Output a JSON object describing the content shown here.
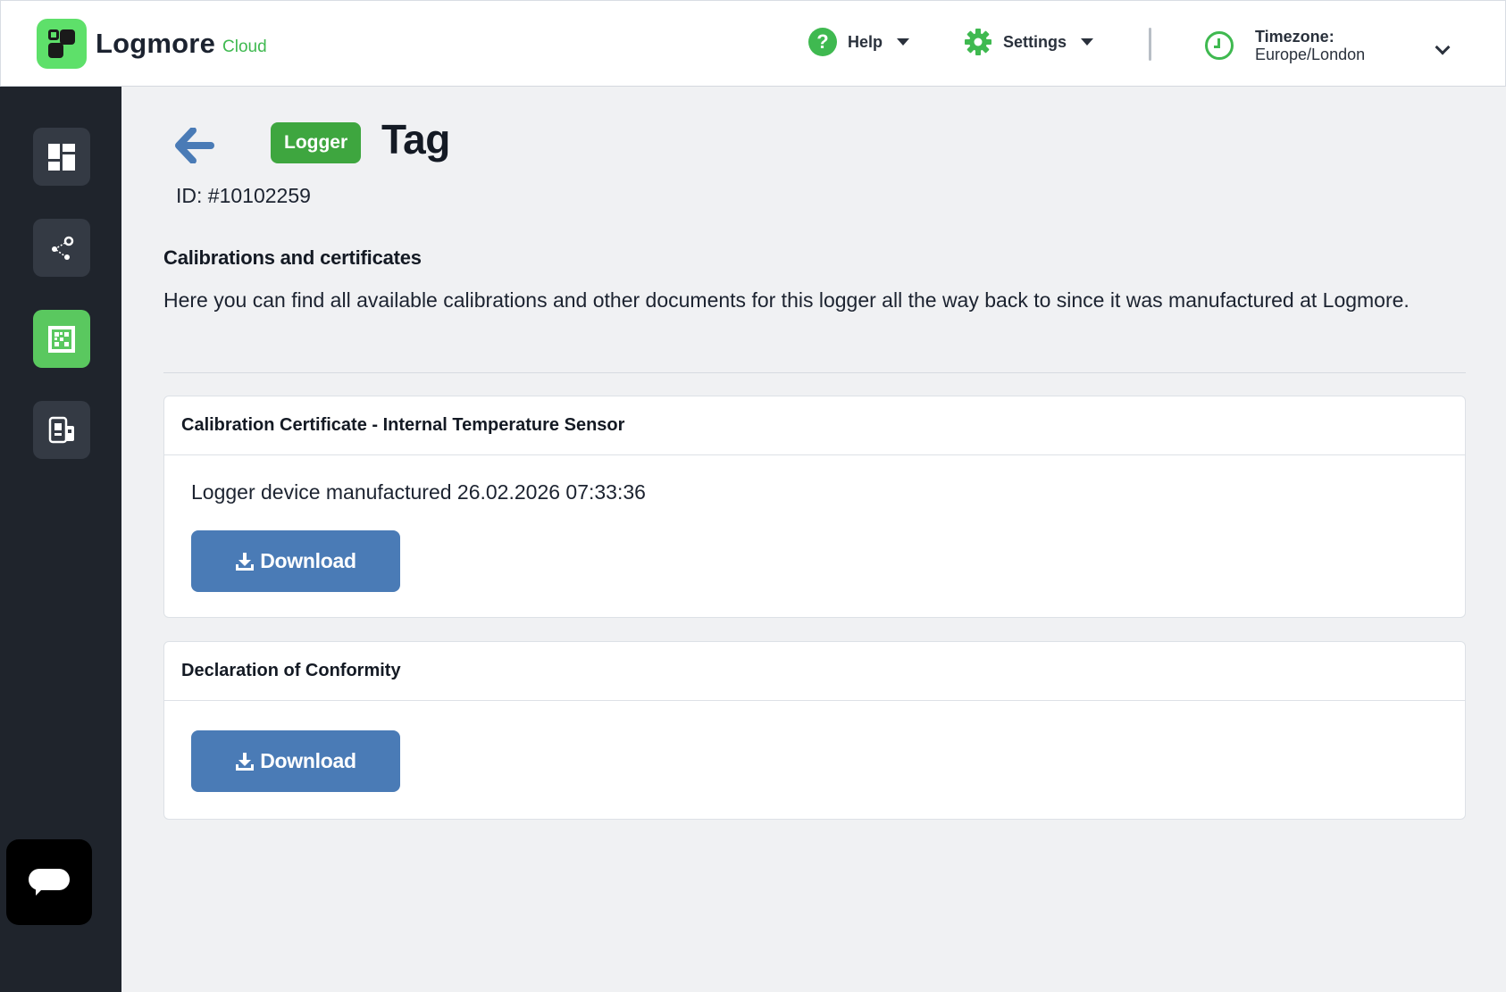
{
  "brand": {
    "name": "Logmore",
    "sub": "Cloud",
    "accent": "#3fb950"
  },
  "header": {
    "help_label": "Help",
    "settings_label": "Settings",
    "timezone_label": "Timezone:",
    "timezone_value": "Europe/London"
  },
  "sidebar": {
    "items": [
      {
        "icon": "dashboard-icon",
        "active": false
      },
      {
        "icon": "share-network-icon",
        "active": false
      },
      {
        "icon": "qr-code-icon",
        "active": true
      },
      {
        "icon": "device-loggers-icon",
        "active": false
      }
    ],
    "chat_icon": "chat-bubble-icon"
  },
  "page": {
    "badge": "Logger",
    "title": "Tag",
    "id_line": "ID: #10102259",
    "section_heading": "Calibrations and certificates",
    "section_desc": "Here you can find all available calibrations and other documents for this logger all the way back to since it was manufactured at Logmore."
  },
  "cards": [
    {
      "title": "Calibration Certificate - Internal Temperature Sensor",
      "text": "Logger device manufactured 26.02.2026 07:33:36",
      "button": "Download"
    },
    {
      "title": "Declaration of Conformity",
      "text": "",
      "button": "Download"
    }
  ],
  "colors": {
    "primary_button": "#4a7bb6",
    "badge": "#3ea63f",
    "sidebar_bg": "#1f242c"
  }
}
